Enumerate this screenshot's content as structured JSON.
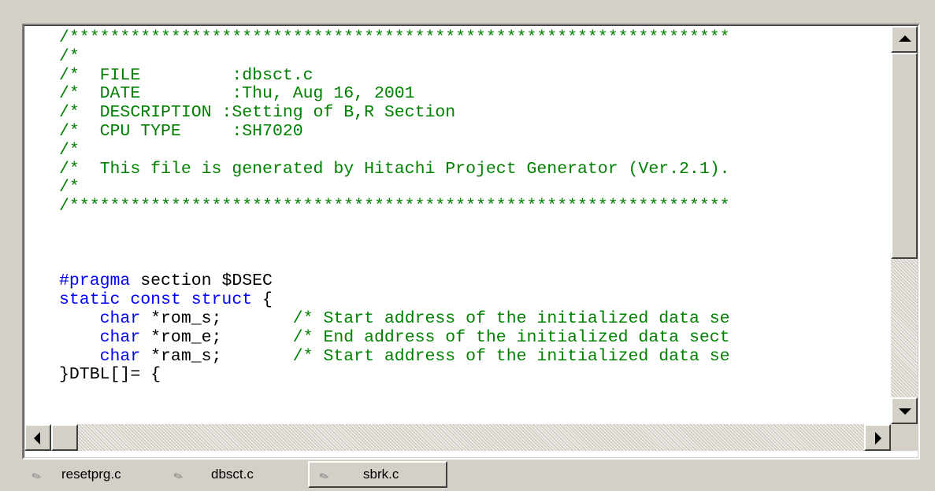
{
  "editor": {
    "lines": [
      [
        {
          "c": "cm",
          "t": "/*****************************************************************"
        }
      ],
      [
        {
          "c": "cm",
          "t": "/*"
        }
      ],
      [
        {
          "c": "cm",
          "t": "/*  FILE         :dbsct.c"
        }
      ],
      [
        {
          "c": "cm",
          "t": "/*  DATE         :Thu, Aug 16, 2001"
        }
      ],
      [
        {
          "c": "cm",
          "t": "/*  DESCRIPTION :Setting of B,R Section"
        }
      ],
      [
        {
          "c": "cm",
          "t": "/*  CPU TYPE     :SH7020"
        }
      ],
      [
        {
          "c": "cm",
          "t": "/*"
        }
      ],
      [
        {
          "c": "cm",
          "t": "/*  This file is generated by Hitachi Project Generator (Ver.2.1)."
        }
      ],
      [
        {
          "c": "cm",
          "t": "/*"
        }
      ],
      [
        {
          "c": "cm",
          "t": "/*****************************************************************"
        }
      ],
      [],
      [],
      [],
      [
        {
          "c": "kw",
          "t": "#pragma"
        },
        {
          "c": "tx",
          "t": " section $DSEC"
        }
      ],
      [
        {
          "c": "kw",
          "t": "static const struct"
        },
        {
          "c": "tx",
          "t": " {"
        }
      ],
      [
        {
          "c": "tx",
          "t": "    "
        },
        {
          "c": "kw",
          "t": "char"
        },
        {
          "c": "tx",
          "t": " *rom_s;       "
        },
        {
          "c": "cm",
          "t": "/* Start address of the initialized data se"
        }
      ],
      [
        {
          "c": "tx",
          "t": "    "
        },
        {
          "c": "kw",
          "t": "char"
        },
        {
          "c": "tx",
          "t": " *rom_e;       "
        },
        {
          "c": "cm",
          "t": "/* End address of the initialized data sect"
        }
      ],
      [
        {
          "c": "tx",
          "t": "    "
        },
        {
          "c": "kw",
          "t": "char"
        },
        {
          "c": "tx",
          "t": " *ram_s;       "
        },
        {
          "c": "cm",
          "t": "/* Start address of the initialized data se"
        }
      ],
      [
        {
          "c": "tx",
          "t": "}DTBL[]= {"
        }
      ]
    ]
  },
  "tabs": [
    {
      "label": "resetprg.c",
      "icon": "file-tab-icon",
      "active": false
    },
    {
      "label": "dbsct.c",
      "icon": "file-tab-icon",
      "active": true
    },
    {
      "label": "sbrk.c",
      "icon": "file-tab-icon",
      "active": false
    }
  ],
  "scrollbars": {
    "vertical_position": 0.0,
    "horizontal_position": 0.0
  }
}
